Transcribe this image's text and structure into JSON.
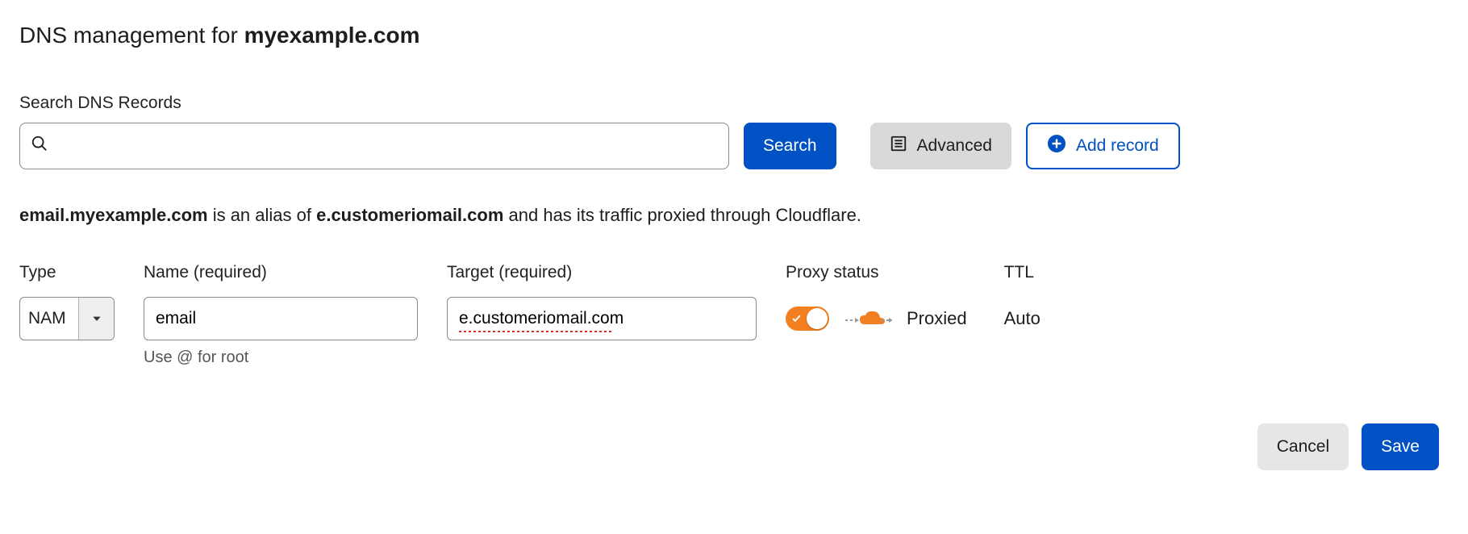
{
  "page": {
    "title_prefix": "DNS management for ",
    "title_domain": "myexample.com"
  },
  "search": {
    "label": "Search DNS Records",
    "placeholder": "",
    "search_button": "Search",
    "advanced_button": "Advanced",
    "add_record_button": "Add record"
  },
  "description": {
    "hostname": "email.myexample.com",
    "mid1": " is an alias of ",
    "alias_target": "e.customeriomail.com",
    "mid2": " and has its traffic proxied through Cloudflare."
  },
  "form": {
    "type": {
      "label": "Type",
      "value": "NAM"
    },
    "name": {
      "label": "Name (required)",
      "value": "email",
      "helper": "Use @ for root"
    },
    "target": {
      "label": "Target (required)",
      "value": "e.customeriomail.com"
    },
    "proxy": {
      "label": "Proxy status",
      "status_text": "Proxied",
      "enabled": true
    },
    "ttl": {
      "label": "TTL",
      "value": "Auto"
    }
  },
  "actions": {
    "cancel": "Cancel",
    "save": "Save"
  },
  "colors": {
    "primary": "#0051c3",
    "accent_orange": "#f38020"
  }
}
